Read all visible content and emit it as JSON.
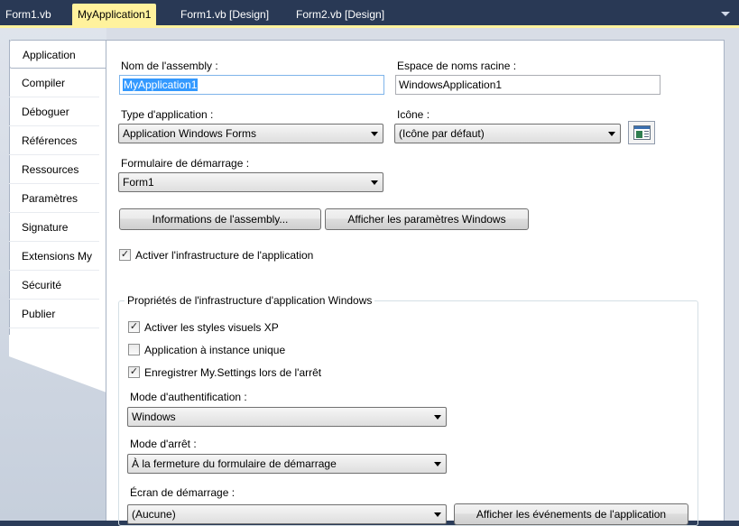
{
  "doc_tabs": [
    {
      "label": "Form1.vb",
      "active": false
    },
    {
      "label": "MyApplication1",
      "active": true
    },
    {
      "label": "Form1.vb [Design]",
      "active": false
    },
    {
      "label": "Form2.vb [Design]",
      "active": false
    }
  ],
  "nav": {
    "items": [
      {
        "label": "Application",
        "selected": true
      },
      {
        "label": "Compiler"
      },
      {
        "label": "Déboguer"
      },
      {
        "label": "Références"
      },
      {
        "label": "Ressources"
      },
      {
        "label": "Paramètres"
      },
      {
        "label": "Signature"
      },
      {
        "label": "Extensions My"
      },
      {
        "label": "Sécurité"
      },
      {
        "label": "Publier"
      }
    ]
  },
  "form": {
    "assembly_name_label": "Nom de l'assembly :",
    "assembly_name_value": "MyApplication1",
    "root_namespace_label": "Espace de noms racine :",
    "root_namespace_value": "WindowsApplication1",
    "app_type_label": "Type d'application :",
    "app_type_value": "Application Windows Forms",
    "icon_label": "Icône :",
    "icon_value": "(Icône par défaut)",
    "startup_form_label": "Formulaire de démarrage :",
    "startup_form_value": "Form1",
    "assembly_info_button": "Informations de l'assembly...",
    "windows_settings_button": "Afficher les paramètres Windows",
    "enable_framework_label": "Activer l'infrastructure de l'application",
    "enable_framework_checked": true
  },
  "framework_group": {
    "title": "Propriétés de l'infrastructure d'application Windows",
    "xp_styles_label": "Activer les styles visuels XP",
    "xp_styles_checked": true,
    "single_instance_label": "Application à instance unique",
    "single_instance_checked": false,
    "save_settings_label": "Enregistrer My.Settings lors de l'arrêt",
    "save_settings_checked": true,
    "auth_mode_label": "Mode d'authentification :",
    "auth_mode_value": "Windows",
    "shutdown_mode_label": "Mode d'arrêt :",
    "shutdown_mode_value": "À la fermeture du formulaire de démarrage",
    "splash_label": "Écran de démarrage :",
    "splash_value": "(Aucune)",
    "view_events_button": "Afficher les événements de l'application"
  },
  "icons": {
    "tab_overflow": "chevron-down-icon",
    "icon_preview": "form-icon",
    "check": "check-icon"
  },
  "colors": {
    "tab_bar": "#293955",
    "active_tab": "#fff29d",
    "text_selection": "#3399ff"
  }
}
